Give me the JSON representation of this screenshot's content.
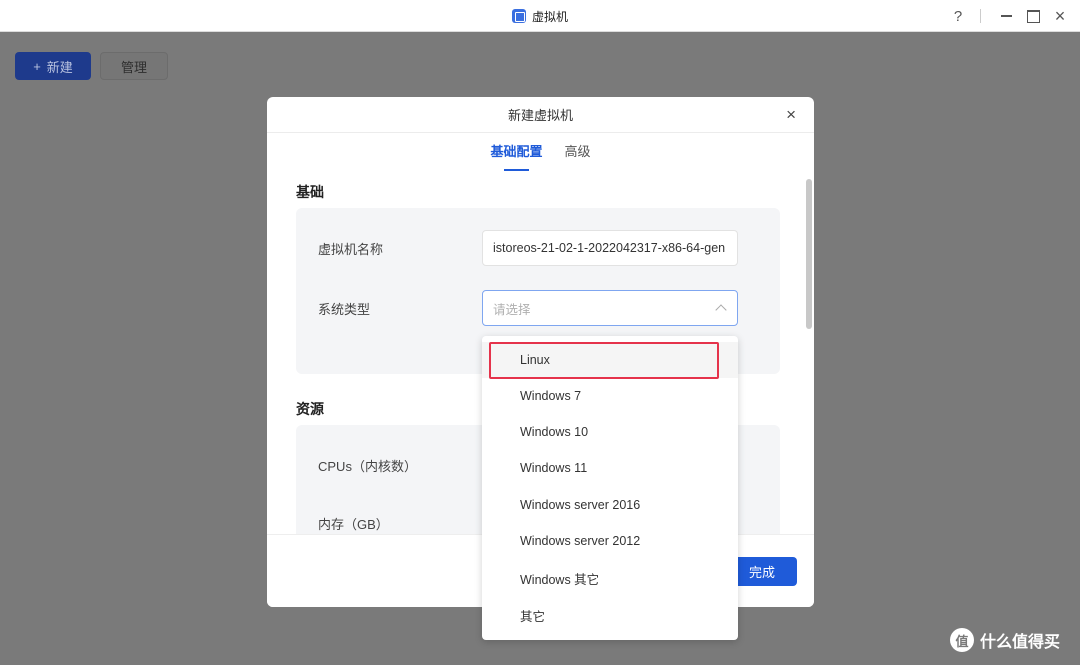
{
  "window": {
    "title": "虚拟机",
    "help_glyph": "?",
    "close_glyph": "×"
  },
  "toolbar": {
    "new_label": "新建",
    "new_glyph": "+",
    "manage_label": "管理"
  },
  "dialog": {
    "title": "新建虚拟机",
    "close_glyph": "×",
    "tabs": [
      {
        "label": "基础配置",
        "active": true
      },
      {
        "label": "高级",
        "active": false
      }
    ],
    "sections": {
      "basic": {
        "title": "基础",
        "name_label": "虚拟机名称",
        "name_value": "istoreos-21-02-1-2022042317-x86-64-gen",
        "type_label": "系统类型",
        "type_placeholder": "请选择"
      },
      "resources": {
        "title": "资源",
        "cpu_label": "CPUs（内核数）",
        "memory_label": "内存（GB）"
      }
    },
    "done_label": "完成"
  },
  "system_type_options": [
    "Linux",
    "Windows 7",
    "Windows 10",
    "Windows 11",
    "Windows server 2016",
    "Windows server 2012",
    "Windows 其它",
    "其它"
  ],
  "highlighted_option": "Linux",
  "watermark": {
    "logo_glyph": "值",
    "text": "什么值得买"
  },
  "colors": {
    "accent": "#1f5bd9",
    "highlight_box": "#e5334b",
    "overlay": "#7a7a7a"
  }
}
